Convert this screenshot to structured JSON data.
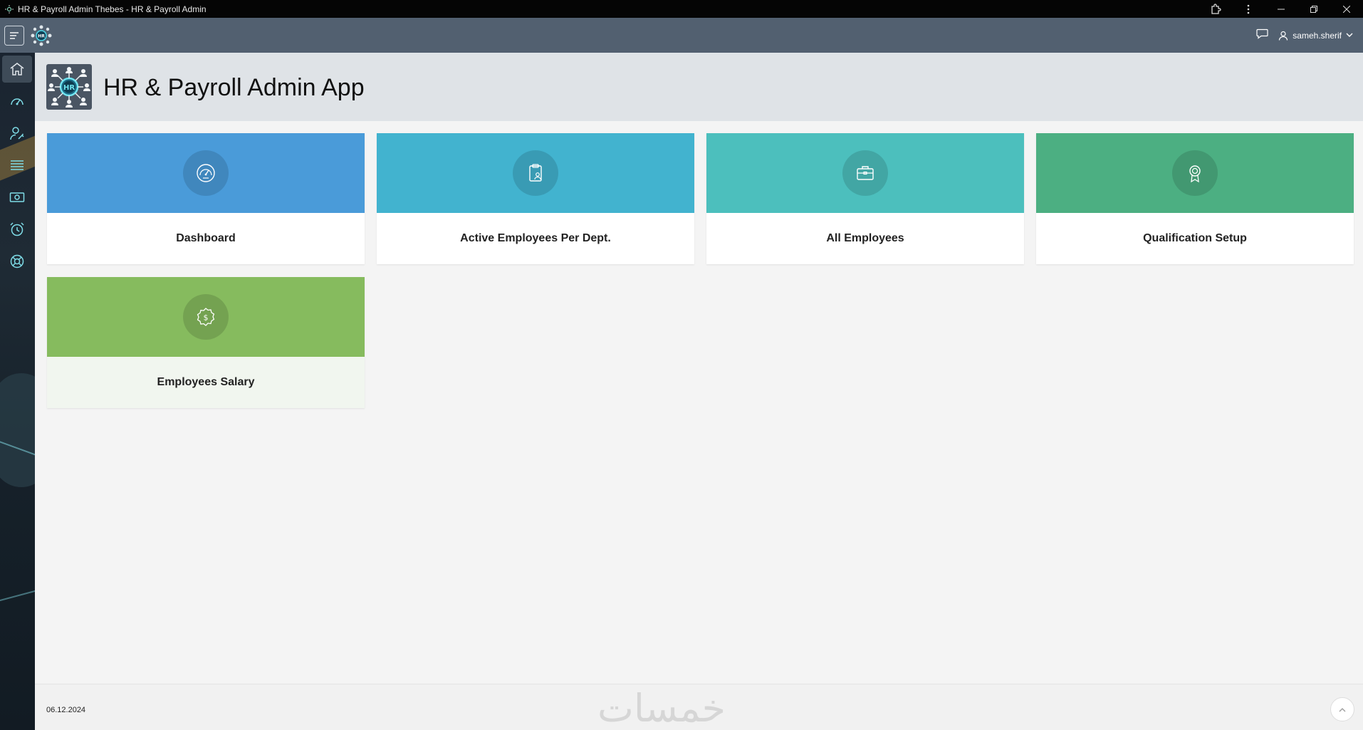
{
  "window": {
    "title": "HR & Payroll Admin Thebes - HR & Payroll Admin"
  },
  "header": {
    "user_name": "sameh.sherif"
  },
  "page": {
    "title": "HR & Payroll Admin App"
  },
  "rail": {
    "items": [
      "home-icon",
      "dashboard-gauge-icon",
      "user-settings-icon",
      "list-icon",
      "money-icon",
      "alarm-clock-icon",
      "support-icon"
    ]
  },
  "tiles": [
    {
      "label": "Dashboard",
      "color": "#4a9bd9",
      "icon": "gauge-icon"
    },
    {
      "label": "Active Employees Per Dept.",
      "color": "#42b3cf",
      "icon": "clipboard-user-icon"
    },
    {
      "label": "All Employees",
      "color": "#4cbfbd",
      "icon": "briefcase-icon"
    },
    {
      "label": "Qualification Setup",
      "color": "#4caf82",
      "icon": "award-icon"
    },
    {
      "label": "Employees Salary",
      "color": "#86bb5e",
      "icon": "dollar-badge-icon"
    }
  ],
  "footer": {
    "date": "06.12.2024",
    "watermark": "خمسات"
  }
}
